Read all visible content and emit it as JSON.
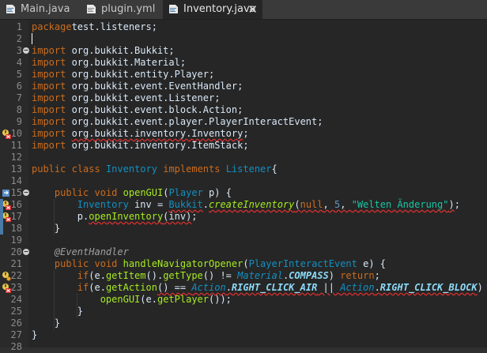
{
  "tabs": [
    {
      "label": "Main.java",
      "icon": "java-file-icon",
      "active": false
    },
    {
      "label": "plugin.yml",
      "icon": "yml-file-icon",
      "active": false
    },
    {
      "label": "Inventory.java",
      "icon": "java-file-icon",
      "active": true,
      "close": "✕"
    }
  ],
  "lines": [
    {
      "n": "1",
      "tokens": [
        [
          "kw",
          "package"
        ],
        [
          "",
          "test.listeners;"
        ]
      ]
    },
    {
      "n": "2",
      "tokens": []
    },
    {
      "n": "3",
      "tokens": [
        [
          "kw",
          "import"
        ],
        [
          "",
          " org.bukkit.Bukkit;"
        ]
      ]
    },
    {
      "n": "4",
      "tokens": [
        [
          "kw",
          "import"
        ],
        [
          "",
          " org.bukkit.Material;"
        ]
      ]
    },
    {
      "n": "5",
      "tokens": [
        [
          "kw",
          "import"
        ],
        [
          "",
          " org.bukkit.entity.Player;"
        ]
      ]
    },
    {
      "n": "6",
      "tokens": [
        [
          "kw",
          "import"
        ],
        [
          "",
          " org.bukkit.event.EventHandler;"
        ]
      ]
    },
    {
      "n": "7",
      "tokens": [
        [
          "kw",
          "import"
        ],
        [
          "",
          " org.bukkit.event.Listener;"
        ]
      ]
    },
    {
      "n": "8",
      "tokens": [
        [
          "kw",
          "import"
        ],
        [
          "",
          " org.bukkit.event.block.Action;"
        ]
      ]
    },
    {
      "n": "9",
      "tokens": [
        [
          "kw",
          "import"
        ],
        [
          "",
          " org.bukkit.event.player.PlayerInteractEvent;"
        ]
      ]
    },
    {
      "n": "10",
      "tokens": [
        [
          "kw",
          "import"
        ],
        [
          "",
          " "
        ],
        [
          "err",
          "org.bukkit.inventory.Inventory"
        ],
        [
          "",
          ";"
        ]
      ]
    },
    {
      "n": "11",
      "tokens": [
        [
          "kw",
          "import"
        ],
        [
          "",
          " org.bukkit.inventory.ItemStack;"
        ]
      ]
    },
    {
      "n": "12",
      "tokens": []
    },
    {
      "n": "13",
      "tokens": [
        [
          "kw",
          "public"
        ],
        [
          "",
          " "
        ],
        [
          "kw",
          "class"
        ],
        [
          "",
          " "
        ],
        [
          "cls",
          "Inventory"
        ],
        [
          "",
          " "
        ],
        [
          "kw",
          "implements"
        ],
        [
          "",
          " "
        ],
        [
          "cls",
          "Listener"
        ],
        [
          "",
          "{"
        ]
      ]
    },
    {
      "n": "14",
      "tokens": []
    },
    {
      "n": "15",
      "tokens": [
        [
          "",
          "    "
        ],
        [
          "kw",
          "public"
        ],
        [
          "",
          " "
        ],
        [
          "kw",
          "void"
        ],
        [
          "",
          " "
        ],
        [
          "fn",
          "openGUI"
        ],
        [
          "",
          "("
        ],
        [
          "cls",
          "Player"
        ],
        [
          "",
          " p) {"
        ]
      ]
    },
    {
      "n": "16",
      "tokens": [
        [
          "",
          "        "
        ],
        [
          "cls",
          "Inventory"
        ],
        [
          "",
          " inv = "
        ],
        [
          "cls err",
          "Bukkit"
        ],
        [
          "",
          "."
        ],
        [
          "fn ital err",
          "createInventory"
        ],
        [
          "err",
          "("
        ],
        [
          "kw err",
          "null"
        ],
        [
          "err",
          ", "
        ],
        [
          "num err",
          "5"
        ],
        [
          "err",
          ", "
        ],
        [
          "str err",
          "\"Welten Änderung\""
        ],
        [
          "err",
          ")"
        ],
        [
          "",
          ";"
        ]
      ]
    },
    {
      "n": "17",
      "tokens": [
        [
          "",
          "        p."
        ],
        [
          "fn err",
          "openInventory"
        ],
        [
          "err",
          "(inv)"
        ],
        [
          "",
          ";"
        ]
      ]
    },
    {
      "n": "18",
      "tokens": [
        [
          "",
          "    }"
        ]
      ]
    },
    {
      "n": "19",
      "tokens": []
    },
    {
      "n": "20",
      "tokens": [
        [
          "",
          "    "
        ],
        [
          "anno",
          "@EventHandler"
        ]
      ]
    },
    {
      "n": "21",
      "tokens": [
        [
          "",
          "    "
        ],
        [
          "kw",
          "public"
        ],
        [
          "",
          " "
        ],
        [
          "kw",
          "void"
        ],
        [
          "",
          " "
        ],
        [
          "fn",
          "handleNavigatorOpener"
        ],
        [
          "",
          "("
        ],
        [
          "cls",
          "PlayerInteractEvent"
        ],
        [
          "",
          " e) {"
        ]
      ]
    },
    {
      "n": "22",
      "tokens": [
        [
          "",
          "        "
        ],
        [
          "kw",
          "if"
        ],
        [
          "",
          "(e."
        ],
        [
          "fn",
          "getItem"
        ],
        [
          "",
          "()."
        ],
        [
          "fn",
          "getType"
        ],
        [
          "",
          "() != "
        ],
        [
          "cls ital",
          "Material"
        ],
        [
          "",
          "."
        ],
        [
          "sfld",
          "COMPASS"
        ],
        [
          "",
          ") "
        ],
        [
          "kw",
          "return"
        ],
        [
          "",
          ";"
        ]
      ]
    },
    {
      "n": "23",
      "tokens": [
        [
          "",
          "        "
        ],
        [
          "kw",
          "if"
        ],
        [
          "",
          "(e."
        ],
        [
          "fn",
          "getAction"
        ],
        [
          "",
          ""
        ],
        [
          "err",
          "() == "
        ],
        [
          "cls ital err",
          "Action"
        ],
        [
          "err",
          "."
        ],
        [
          "sfld err",
          "RIGHT_CLICK_AIR"
        ],
        [
          "err",
          " || "
        ],
        [
          "cls ital err",
          "Action"
        ],
        [
          "err",
          "."
        ],
        [
          "sfld err",
          "RIGHT_CLICK_BLOCK"
        ],
        [
          "",
          ") {"
        ]
      ]
    },
    {
      "n": "24",
      "tokens": [
        [
          "",
          "            "
        ],
        [
          "fn",
          "openGUI"
        ],
        [
          "",
          "(e."
        ],
        [
          "fn",
          "getPlayer"
        ],
        [
          "",
          "());"
        ]
      ]
    },
    {
      "n": "25",
      "tokens": [
        [
          "",
          "        }"
        ]
      ]
    },
    {
      "n": "26",
      "tokens": [
        [
          "",
          "    }"
        ]
      ]
    },
    {
      "n": "27",
      "tokens": [
        [
          "",
          "}"
        ]
      ]
    },
    {
      "n": "28",
      "tokens": []
    }
  ],
  "markers": {
    "10": "warning-error-icon",
    "15": "override-icon",
    "16": "warning-error-icon",
    "17": "warning-error-icon",
    "22": "warning-icon",
    "23": "warning-error-icon"
  },
  "folds": [
    "3",
    "15",
    "20"
  ],
  "colors": {
    "keyword": "#cc6c1d",
    "class": "#1290c3",
    "string": "#17c6a3",
    "method": "#a7ec21",
    "static_field": "#8ddaf8",
    "error_underline": "#e03030"
  }
}
